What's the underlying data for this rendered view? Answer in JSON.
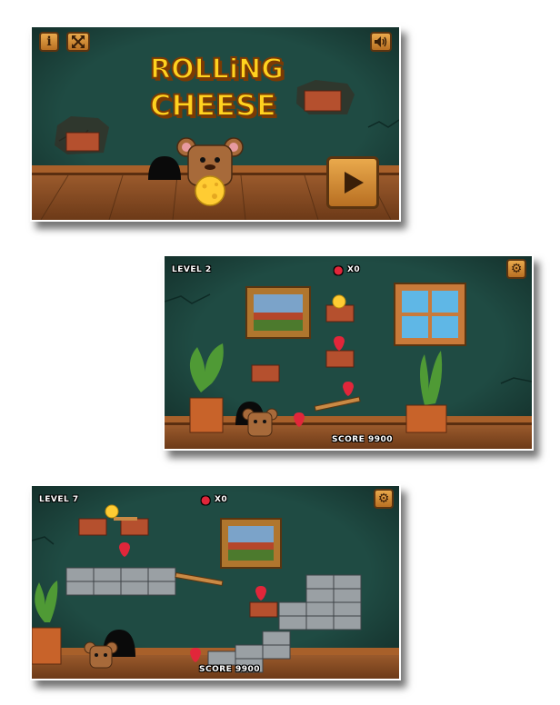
{
  "menu": {
    "title_line1": "ROLLiNG",
    "title_line2": "CHEESE",
    "info_icon": "info-icon",
    "fullscreen_icon": "fullscreen-icon",
    "sound_icon": "speaker-icon",
    "play_icon": "play-icon"
  },
  "level2": {
    "level_label": "LEVEL 2",
    "strawberry_count": "X0",
    "score_label": "SCORE 9900",
    "settings_icon": "gear-icon"
  },
  "level7": {
    "level_label": "LEVEL 7",
    "strawberry_count": "X0",
    "score_label": "SCORE 9900",
    "settings_icon": "gear-icon"
  },
  "colors": {
    "wall": "#1f4b43",
    "floor": "#8a4e24",
    "wood_button": "#d58d3a",
    "title_yellow": "#ffd21f"
  }
}
